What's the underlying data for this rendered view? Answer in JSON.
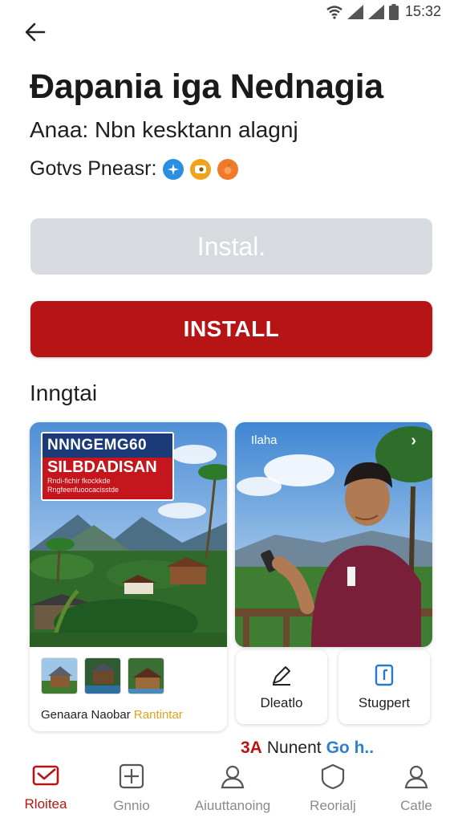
{
  "status_bar": {
    "time": "15:32",
    "icons": [
      "wifi-icon",
      "signal-icon",
      "signal-icon",
      "battery-icon"
    ]
  },
  "header": {
    "back_icon": "arrow-left-icon"
  },
  "app": {
    "title": "Đapania iga Nednagia",
    "subtitle": "Anaa: Nbn kesktann alagnj",
    "meta_label": "Gotvs Pneasr:",
    "meta_icons": [
      "blue-badge-icon",
      "orange-badge-icon",
      "peach-icon"
    ]
  },
  "buttons": {
    "install_light": "Instal.",
    "install_primary": "INSTALL"
  },
  "section": {
    "heading": "Inngtai"
  },
  "card_left": {
    "banner_line1": "NNNGEMG60",
    "banner_line2": "SILBDADISAN",
    "banner_small1": "Rndi-fichir  fkockkde",
    "banner_small2": "Rngfeenfuoocacisstde",
    "caption_main": "Genaara Naobar",
    "caption_highlight": "Rantintar"
  },
  "card_right": {
    "tag": "Ilaha",
    "chevron": "›"
  },
  "mini_cards": [
    {
      "label": "Dleatlo",
      "icon": "pencil-icon"
    },
    {
      "label": "Stugpert",
      "icon": "document-icon"
    }
  ],
  "promo": {
    "logo": "3A",
    "text": "Nunent",
    "brand": "Go h.."
  },
  "bottom_nav": [
    {
      "label": "Rloitea",
      "icon": "mail-icon",
      "active": true
    },
    {
      "label": "Gnnio",
      "icon": "plus-square-icon",
      "active": false
    },
    {
      "label": "Aiuuttanoing",
      "icon": "person-icon",
      "active": false
    },
    {
      "label": "Reorialj",
      "icon": "shield-icon",
      "active": false
    },
    {
      "label": "Catle",
      "icon": "person-icon",
      "active": false
    }
  ],
  "colors": {
    "accent_red": "#b71515",
    "disabled_button": "#d7dbe0",
    "nav_inactive": "#8a8a8a"
  }
}
